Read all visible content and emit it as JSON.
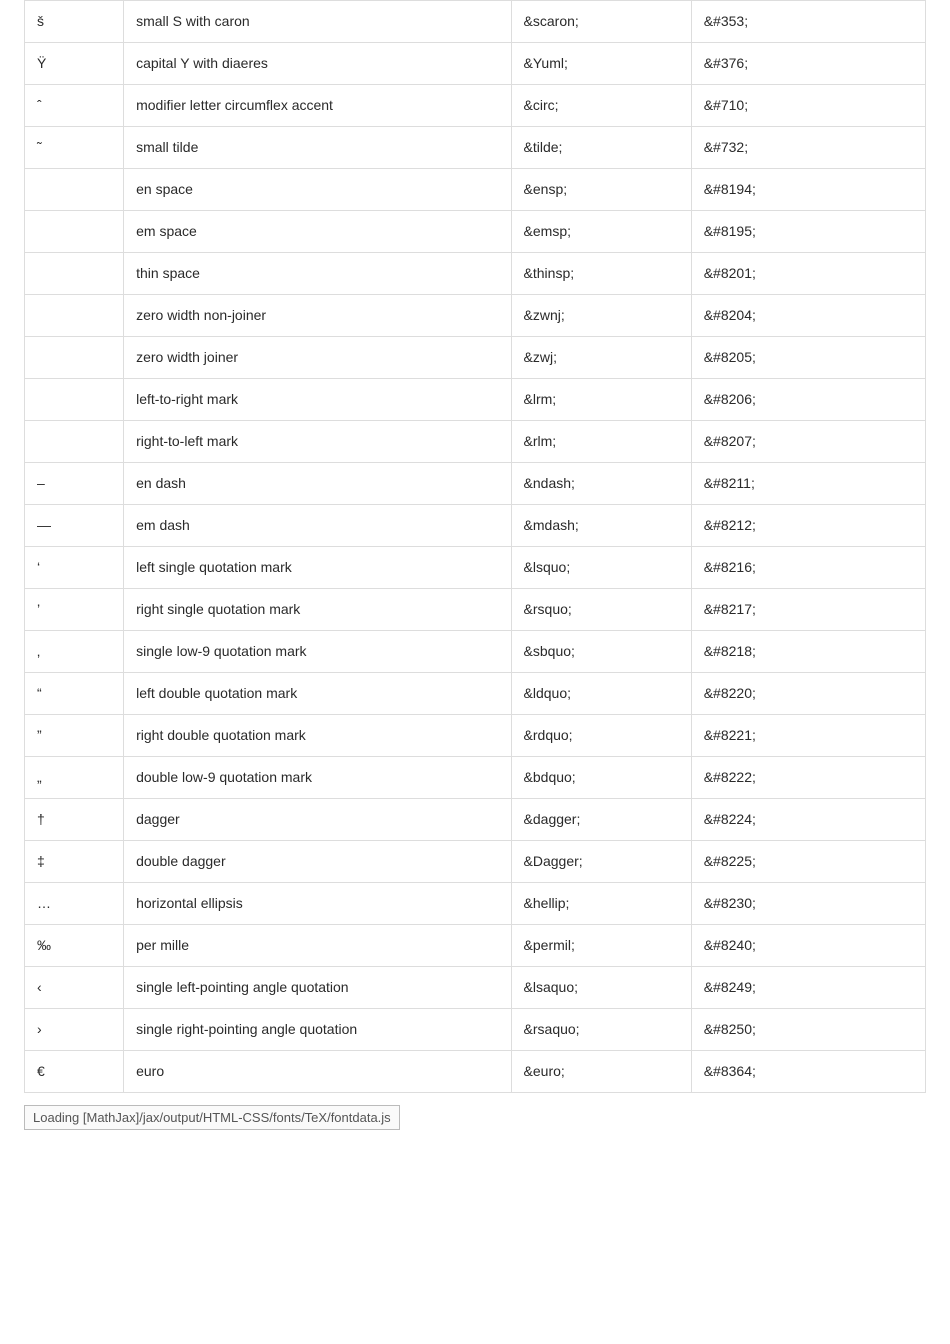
{
  "table": {
    "rows": [
      {
        "char": "š",
        "desc": "small S with caron",
        "name": "&scaron;",
        "num": "&#353;"
      },
      {
        "char": "Ÿ",
        "desc": "capital Y with diaeres",
        "name": "&Yuml;",
        "num": "&#376;"
      },
      {
        "char": "ˆ",
        "desc": "modifier letter circumflex accent",
        "name": "&circ;",
        "num": "&#710;"
      },
      {
        "char": "˜",
        "desc": "small tilde",
        "name": "&tilde;",
        "num": "&#732;"
      },
      {
        "char": " ",
        "desc": "en space",
        "name": "&ensp;",
        "num": "&#8194;"
      },
      {
        "char": " ",
        "desc": "em space",
        "name": "&emsp;",
        "num": "&#8195;"
      },
      {
        "char": " ",
        "desc": "thin space",
        "name": "&thinsp;",
        "num": "&#8201;"
      },
      {
        "char": "",
        "desc": "zero width non-joiner",
        "name": "&zwnj;",
        "num": "&#8204;"
      },
      {
        "char": "",
        "desc": "zero width joiner",
        "name": "&zwj;",
        "num": "&#8205;"
      },
      {
        "char": "",
        "desc": "left-to-right mark",
        "name": "&lrm;",
        "num": "&#8206;"
      },
      {
        "char": "",
        "desc": "right-to-left mark",
        "name": "&rlm;",
        "num": "&#8207;"
      },
      {
        "char": "–",
        "desc": "en dash",
        "name": "&ndash;",
        "num": "&#8211;"
      },
      {
        "char": "—",
        "desc": "em dash",
        "name": "&mdash;",
        "num": "&#8212;"
      },
      {
        "char": "‘",
        "desc": "left single quotation mark",
        "name": "&lsquo;",
        "num": "&#8216;"
      },
      {
        "char": "’",
        "desc": "right single quotation mark",
        "name": "&rsquo;",
        "num": "&#8217;"
      },
      {
        "char": "‚",
        "desc": "single low-9 quotation mark",
        "name": "&sbquo;",
        "num": "&#8218;"
      },
      {
        "char": "“",
        "desc": "left double quotation mark",
        "name": "&ldquo;",
        "num": "&#8220;"
      },
      {
        "char": "”",
        "desc": "right double quotation mark",
        "name": "&rdquo;",
        "num": "&#8221;"
      },
      {
        "char": "„",
        "desc": "double low-9 quotation mark",
        "name": "&bdquo;",
        "num": "&#8222;"
      },
      {
        "char": "†",
        "desc": "dagger",
        "name": "&dagger;",
        "num": "&#8224;"
      },
      {
        "char": "‡",
        "desc": "double dagger",
        "name": "&Dagger;",
        "num": "&#8225;"
      },
      {
        "char": "…",
        "desc": "horizontal ellipsis",
        "name": "&hellip;",
        "num": "&#8230;"
      },
      {
        "char": "‰",
        "desc": "per mille",
        "name": "&permil;",
        "num": "&#8240;"
      },
      {
        "char": "‹",
        "desc": "single left-pointing angle quotation",
        "name": "&lsaquo;",
        "num": "&#8249;"
      },
      {
        "char": "›",
        "desc": "single right-pointing angle quotation",
        "name": "&rsaquo;",
        "num": "&#8250;"
      },
      {
        "char": "€",
        "desc": "euro",
        "name": "&euro;",
        "num": "&#8364;"
      }
    ]
  },
  "status": {
    "text": "Loading [MathJax]/jax/output/HTML-CSS/fonts/TeX/fontdata.js"
  }
}
